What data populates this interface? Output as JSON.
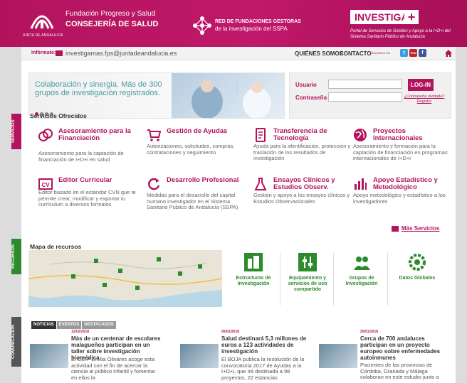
{
  "header": {
    "junta_text": "JUNTA DE ANDALUCIA",
    "fps_line1": "Fundación Progreso y Salud",
    "fps_line2": "CONSEJERÍA DE SALUD",
    "red_line1": "RED DE FUNDACIONES GESTORAS",
    "red_line2": "de la investigación del SSPA",
    "investiga": "INVESTIGA",
    "investiga_plus": "+",
    "investiga_sub": "Portal de Servicios de Gestión y Apoyo a la I+D+i del Sistema Sanitario Público de Andalucía"
  },
  "infobar": {
    "label": "Infórmate:",
    "email": "investigamas.fps@juntadeandalucia.es",
    "links": [
      "QUIÉNES SOMOS",
      "CONTACTO"
    ],
    "social_caption": "SÍGUENOS EN",
    "social": [
      "t",
      "You",
      "f"
    ]
  },
  "banner": {
    "text": "Colaboración y sinergia. Más de 300 grupos de investigación registrados."
  },
  "login": {
    "user_label": "Usuario",
    "password_label": "Contraseña",
    "button": "LOG-IN",
    "forgot": "¿Contraseña olvidada?",
    "register": "Registro"
  },
  "servicios": {
    "tag": "SERVICIOS",
    "title": "Servicios Ofrecidos",
    "items": [
      {
        "name": "Asesoramiento para la Financiación",
        "desc": "Asesoramiento para la captación de financiación de I+D+i en salud"
      },
      {
        "name": "Gestión de Ayudas",
        "desc": "Autorizaciones, solicitudes, compras, contrataciones y seguimiento"
      },
      {
        "name": "Transferencia de Tecnología",
        "desc": "Ayuda para la identificación, protección y traslación de los resultados de investigación"
      },
      {
        "name": "Proyectos Internacionales",
        "desc": "Asesoramiento y formación para la captación de financiación en programas internacionales de I+D+i"
      },
      {
        "name": "Editor Curricular",
        "desc": "Editor basado en el estándar CVN que te permite crear, modificar y exportar tu currículum a diversos formatos"
      },
      {
        "name": "Desarrollo Profesional",
        "desc": "Medidas para el desarrollo del capital humano investigador en el Sistema Sanitario Público de Andalucía (SSPA)"
      },
      {
        "name": "Ensayos Clínicos y Estudios Observ.",
        "desc": "Gestión y apoyo a los ensayos clínicos y Estudios Observacionales"
      },
      {
        "name": "Apoyo Estadístico y Metodológico",
        "desc": "Apoyo metodológico y estadístico a los investigadores"
      }
    ],
    "more": "Más Servicios"
  },
  "recursos": {
    "tag": "RECURSOS",
    "title": "Mapa de recursos",
    "items": [
      {
        "name": "Estructuras de Investigación"
      },
      {
        "name": "Equipamiento y servicios de uso compartido"
      },
      {
        "name": "Grupos de Investigación"
      },
      {
        "name": "Datos Globales"
      }
    ]
  },
  "comunicacion": {
    "tag": "COMUNICACIÓN",
    "tabs": [
      "NOTICIAS",
      "EVENTOS",
      "DESTACADOS"
    ],
    "news": [
      {
        "date": "12/02/2018",
        "title": "Más de un centenar de escolares malagueños participan en un taller sobre investigación biomédica",
        "text": "El CEIP Emilia Olivares acoge esta actividad con el fin de acercar la ciencia al público infantil y fomentar en ellos la"
      },
      {
        "date": "06/02/2018",
        "title": "Salud destinará 5,3 millones de euros a 123 actividades de investigación",
        "text": "El BOJA publica la resolución de la convocatoria 2017 de Ayudas a la I+D+i, que irá destinada a 98 proyectos, 22 estancias"
      },
      {
        "date": "25/01/2018",
        "title": "Cerca de 700 andaluces participan en un proyecto europeo sobre enfermedades autoinmunes",
        "text": "Pacientes de las provincias de Córdoba, Granada y Málaga colaboran en este estudio junto a"
      }
    ]
  },
  "colors": {
    "brand": "#b3135d",
    "green": "#2d8a2d",
    "teal": "#4a9b9b"
  }
}
